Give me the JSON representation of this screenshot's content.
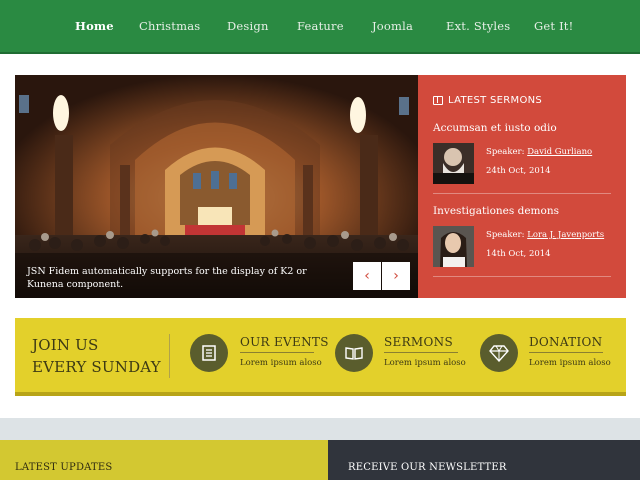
{
  "nav": {
    "items": [
      {
        "label": "Home",
        "active": true
      },
      {
        "label": "Christmas",
        "active": false
      },
      {
        "label": "Design",
        "active": false
      },
      {
        "label": "Feature",
        "active": false
      },
      {
        "label": "Joomla",
        "active": false
      },
      {
        "label": "Ext. Styles",
        "active": false
      },
      {
        "label": "Get It!",
        "active": false
      }
    ]
  },
  "hero": {
    "caption": "JSN Fidem automatically supports for the display of K2 or Kunena component.",
    "prev_icon": "chevron-left-icon",
    "next_icon": "chevron-right-icon"
  },
  "sermons": {
    "heading": "LATEST SERMONS",
    "heading_icon": "book-icon",
    "speaker_prefix": "Speaker:",
    "items": [
      {
        "title": "Accumsan et iusto odio",
        "speaker": "David Gurliano",
        "date": "24th Oct, 2014"
      },
      {
        "title": "Investigationes demons",
        "speaker": "Lora J. Javenports",
        "date": "14th Oct, 2014"
      }
    ]
  },
  "band": {
    "join_line1": "JOIN US",
    "join_line2": "EVERY SUNDAY",
    "features": [
      {
        "title": "OUR EVENTS",
        "text": "Lorem ipsum aloso",
        "icon": "list-icon"
      },
      {
        "title": "SERMONS",
        "text": "Lorem ipsum aloso",
        "icon": "book-icon"
      },
      {
        "title": "DONATION",
        "text": "Lorem ipsum aloso",
        "icon": "diamond-icon"
      }
    ]
  },
  "footer": {
    "updates_title": "LATEST UPDATES",
    "newsletter_title": "RECEIVE OUR NEWSLETTER"
  },
  "colors": {
    "nav_green": "#2a8a42",
    "sermon_red": "#d24a3c",
    "band_yellow": "#e3d02b",
    "icon_olive": "#5a5d2d",
    "newsletter_dark": "#30343c"
  }
}
